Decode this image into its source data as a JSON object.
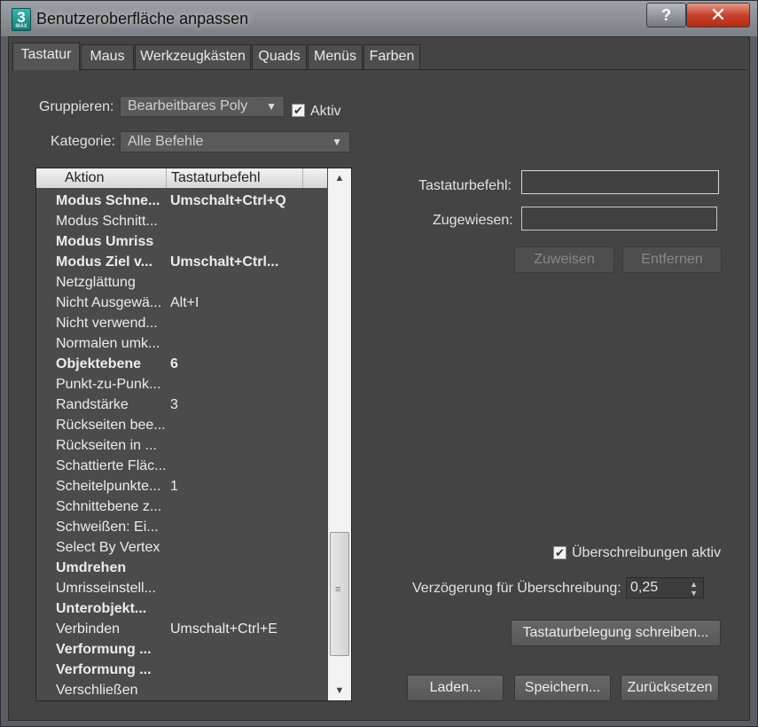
{
  "window": {
    "title": "Benutzeroberfläche anpassen",
    "icon_label": "3",
    "icon_sublabel": "MAX",
    "help_label": "?",
    "close_label": "✕"
  },
  "tabs": [
    {
      "label": "Tastatur",
      "active": true
    },
    {
      "label": "Maus"
    },
    {
      "label": "Werkzeugkästen"
    },
    {
      "label": "Quads"
    },
    {
      "label": "Menüs"
    },
    {
      "label": "Farben"
    }
  ],
  "group": {
    "label": "Gruppieren:",
    "value": "Bearbeitbares Poly",
    "active_label": "Aktiv",
    "active_checked": true
  },
  "category": {
    "label": "Kategorie:",
    "value": "Alle Befehle"
  },
  "list": {
    "columns": [
      "Aktion",
      "Tastaturbefehl"
    ],
    "rows": [
      {
        "action": "Modus Schne...",
        "shortcut": "Umschalt+Ctrl+Q",
        "bold": true
      },
      {
        "action": "Modus Schnitt...",
        "shortcut": ""
      },
      {
        "action": "Modus Umriss",
        "shortcut": "",
        "bold": true
      },
      {
        "action": "Modus Ziel v...",
        "shortcut": "Umschalt+Ctrl...",
        "bold": true
      },
      {
        "action": "Netzglättung",
        "shortcut": ""
      },
      {
        "action": "Nicht Ausgewä...",
        "shortcut": "Alt+I"
      },
      {
        "action": "Nicht verwend...",
        "shortcut": ""
      },
      {
        "action": "Normalen umk...",
        "shortcut": ""
      },
      {
        "action": "Objektebene",
        "shortcut": "6",
        "bold": true
      },
      {
        "action": "Punkt-zu-Punk...",
        "shortcut": ""
      },
      {
        "action": "Randstärke",
        "shortcut": "3"
      },
      {
        "action": "Rückseiten bee...",
        "shortcut": ""
      },
      {
        "action": "Rückseiten in ...",
        "shortcut": ""
      },
      {
        "action": "Schattierte Fläc...",
        "shortcut": ""
      },
      {
        "action": "Scheitelpunkte...",
        "shortcut": "1"
      },
      {
        "action": "Schnittebene z...",
        "shortcut": ""
      },
      {
        "action": "Schweißen: Ei...",
        "shortcut": ""
      },
      {
        "action": "Select By Vertex",
        "shortcut": ""
      },
      {
        "action": "Umdrehen",
        "shortcut": "",
        "bold": true
      },
      {
        "action": "Umrisseinstell...",
        "shortcut": ""
      },
      {
        "action": "Unterobjekt...",
        "shortcut": "",
        "bold": true
      },
      {
        "action": "Verbinden",
        "shortcut": "Umschalt+Ctrl+E"
      },
      {
        "action": "Verformung ...",
        "shortcut": "",
        "bold": true
      },
      {
        "action": "Verformung ...",
        "shortcut": "",
        "bold": true
      },
      {
        "action": "Verschließen",
        "shortcut": ""
      }
    ]
  },
  "shortcut_panel": {
    "shortcut_label": "Tastaturbefehl:",
    "shortcut_value": "",
    "assigned_label": "Zugewiesen:",
    "assigned_value": "",
    "assign_button": "Zuweisen",
    "remove_button": "Entfernen"
  },
  "overrides": {
    "label": "Überschreibungen aktiv",
    "checked": true
  },
  "delay": {
    "label": "Verzögerung für Überschreibung:",
    "value": "0,25"
  },
  "buttons": {
    "write_keyboard": "Tastaturbelegung schreiben...",
    "load": "Laden...",
    "save": "Speichern...",
    "reset": "Zurücksetzen"
  }
}
